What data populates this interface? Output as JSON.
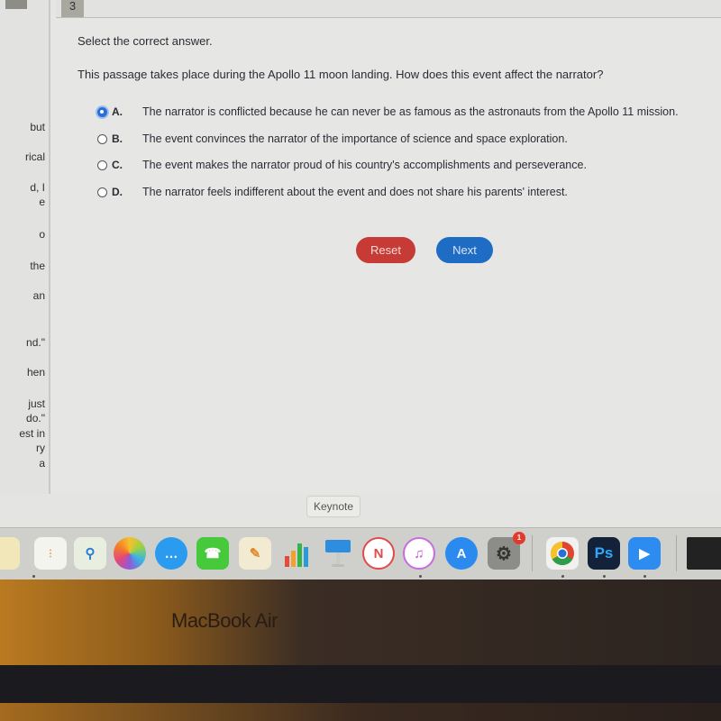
{
  "passage_fragments": [
    "but",
    "rical",
    "d, I",
    "e",
    "o",
    "the",
    "an",
    "nd.\"",
    "hen",
    "just",
    "do.\"",
    "est in",
    "ry",
    "a"
  ],
  "question_number": "3",
  "instruction": "Select the correct answer.",
  "question": "This passage takes place during the Apollo 11 moon landing. How does this event affect the narrator?",
  "options": [
    {
      "letter": "A.",
      "text": "The narrator is conflicted because he can never be as famous as the astronauts from the Apollo 11 mission.",
      "selected": true
    },
    {
      "letter": "B.",
      "text": "The event convinces the narrator of the importance of science and space exploration.",
      "selected": false
    },
    {
      "letter": "C.",
      "text": "The event makes the narrator proud of his country's accomplishments and perseverance.",
      "selected": false
    },
    {
      "letter": "D.",
      "text": "The narrator feels indifferent about the event and does not share his parents' interest.",
      "selected": false
    }
  ],
  "buttons": {
    "reset": "Reset",
    "next": "Next"
  },
  "colors": {
    "reset": "#c63b35",
    "next": "#1f6cc4",
    "selected_radio": "#2a6fd6"
  },
  "dock": {
    "tooltip": "Keynote",
    "apps": [
      "Notes",
      "Reminders",
      "Maps",
      "Photos",
      "Messages",
      "FaceTime",
      "Pages",
      "Numbers",
      "Keynote",
      "News",
      "iTunes",
      "App Store",
      "System Preferences",
      "Chrome",
      "Photoshop",
      "Zoom"
    ],
    "system_preferences_badge": "1",
    "photoshop_label": "Ps"
  },
  "bezel_label": "MacBook Air"
}
